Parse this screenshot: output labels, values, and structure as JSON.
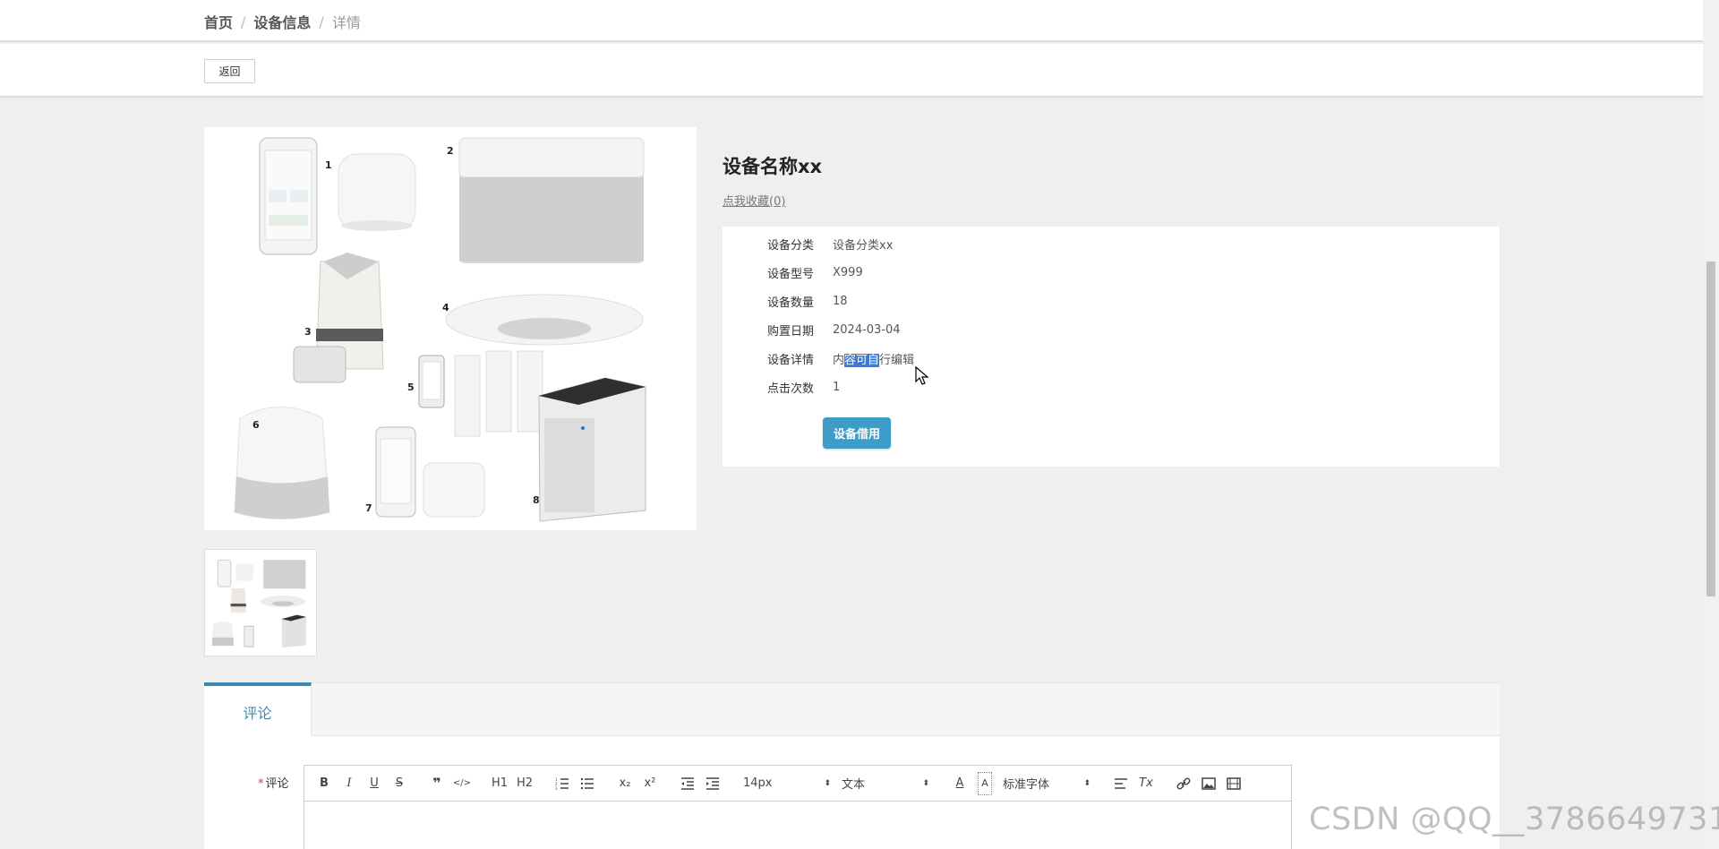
{
  "breadcrumb": {
    "home": "首页",
    "section": "设备信息",
    "current": "详情",
    "sep": "/"
  },
  "back_button": "返回",
  "device": {
    "name": "设备名称xx",
    "favorite_link": "点我收藏(0)",
    "fields": [
      {
        "label": "设备分类",
        "value": "设备分类xx"
      },
      {
        "label": "设备型号",
        "value": "X999"
      },
      {
        "label": "设备数量",
        "value": "18"
      },
      {
        "label": "购置日期",
        "value": "2024-03-04"
      },
      {
        "label": "设备详情",
        "value_pre": "内",
        "value_sel": "容可自",
        "value_post": "行编辑"
      },
      {
        "label": "点击次数",
        "value": "1"
      }
    ],
    "borrow_button": "设备借用"
  },
  "photo_labels": [
    "1",
    "2",
    "3",
    "4",
    "5",
    "6",
    "7",
    "8"
  ],
  "tabs": {
    "active": "评论"
  },
  "comment": {
    "required_mark": "*",
    "label": "评论",
    "toolbar": {
      "bold": "B",
      "italic": "I",
      "underline": "U",
      "strike": "S",
      "quote": "❞",
      "code": "</>",
      "h1": "H1",
      "h2": "H2",
      "sub": "x₂",
      "sup": "x²",
      "font_size": "14px",
      "text_type": "文本",
      "font_family": "标准字体",
      "color": "A",
      "bg": "A",
      "clean": "Tx"
    }
  },
  "watermark": "CSDN @QQ__3786649731",
  "colors": {
    "accent": "#3d9cc8",
    "tab_accent": "#3d87b0",
    "selection": "#3a7ad9"
  }
}
